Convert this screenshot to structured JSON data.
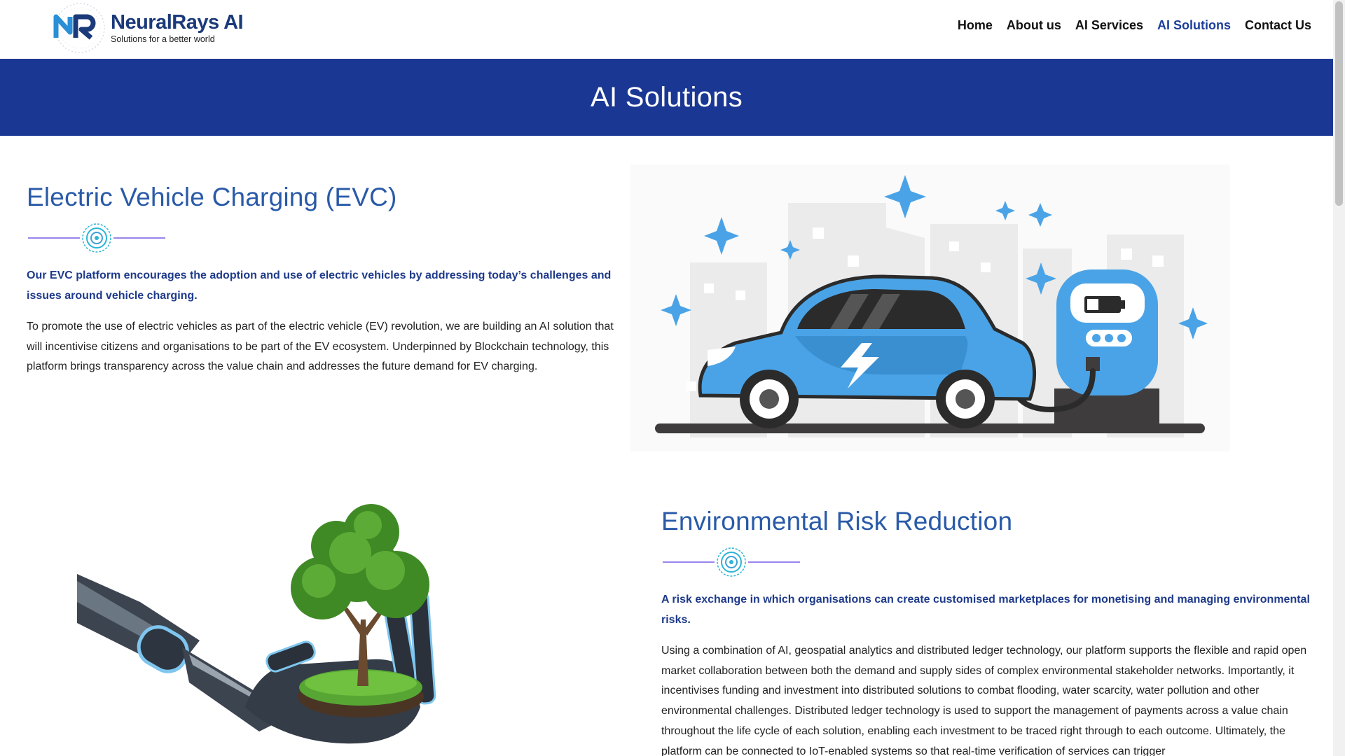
{
  "header": {
    "logo_name": "NeuralRays AI",
    "logo_tagline": "Solutions for a better world",
    "nav": [
      {
        "label": "Home",
        "active": false
      },
      {
        "label": "About us",
        "active": false
      },
      {
        "label": "AI Services",
        "active": false
      },
      {
        "label": "AI Solutions",
        "active": true
      },
      {
        "label": "Contact Us",
        "active": false
      }
    ]
  },
  "banner": {
    "title": "AI Solutions"
  },
  "sections": [
    {
      "title": "Electric Vehicle Charging (EVC)",
      "lead": "Our EVC platform encourages the adoption and use of electric vehicles by addressing today’s challenges and issues around vehicle charging.",
      "body": "To promote the use of electric vehicles as part of the electric vehicle (EV) revolution, we are building an AI solution that will incentivise citizens and organisations to be part of the EV ecosystem. Underpinned by Blockchain technology, this platform brings transparency across the value chain and addresses the future demand for EV charging."
    },
    {
      "title": "Environmental Risk Reduction",
      "lead": "A risk exchange in which organisations can create customised marketplaces for monetising and managing environmental risks.",
      "body": "Using a combination of AI, geospatial analytics and distributed ledger technology, our platform supports the flexible and rapid open market collaboration between both the demand and supply sides of complex environmental stakeholder networks. Importantly, it incentivises funding and investment into distributed solutions to combat flooding, water scarcity, water pollution and other environmental challenges. Distributed ledger technology is used to support the management of payments across a value chain throughout the life cycle of each solution, enabling each investment to be traced right through to each outcome. Ultimately, the platform can be connected to IoT-enabled systems so that real-time verification of services can trigger"
    }
  ],
  "colors": {
    "brand_blue": "#1b3794",
    "heading_blue": "#2a5aa8",
    "lead_blue": "#1e3a8a",
    "active_nav": "#1d3f9a",
    "accent_purple": "#7b5ce6",
    "accent_cyan": "#2bb5d6"
  },
  "icons": [
    "neuralrays-logo-icon",
    "circuit-divider-icon",
    "ev-charging-illustration",
    "robot-hand-tree-illustration"
  ]
}
